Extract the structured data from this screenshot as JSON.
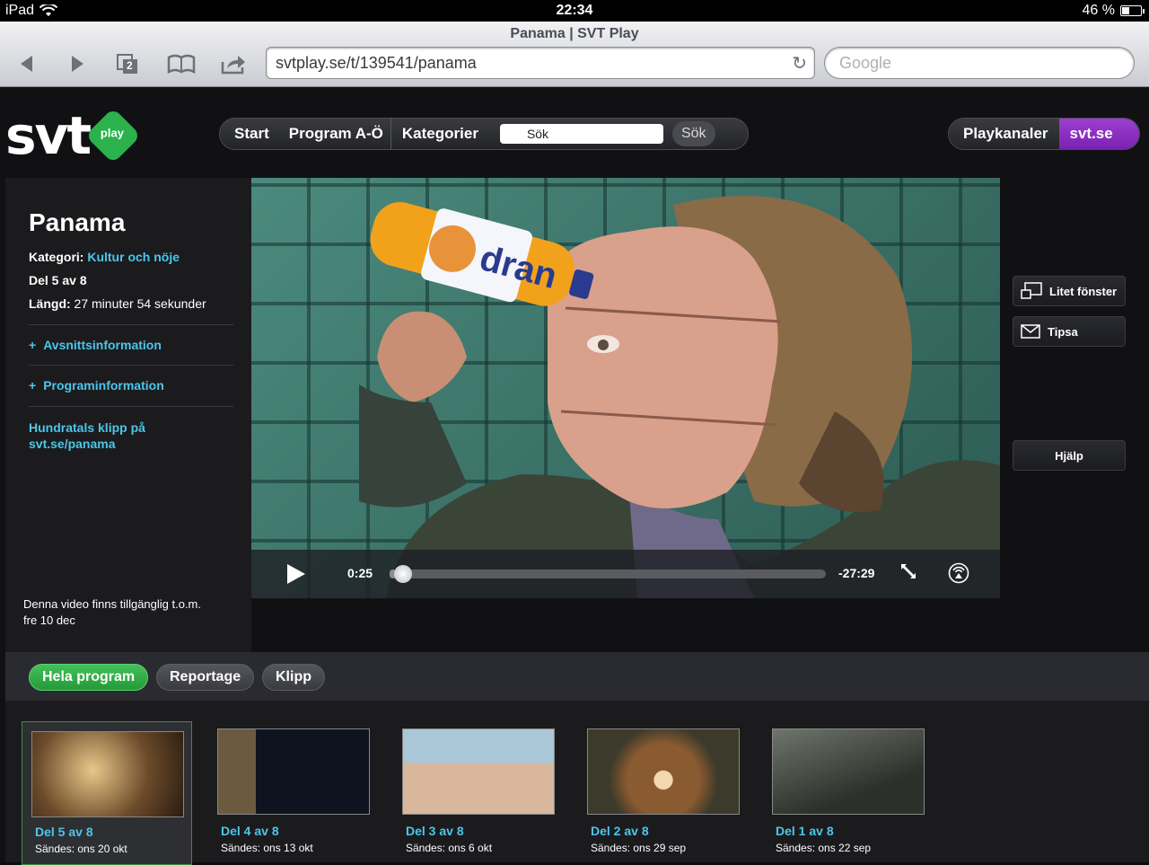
{
  "statusbar": {
    "device": "iPad",
    "time": "22:34",
    "battery": "46 %",
    "battery_level": 0.46
  },
  "browser": {
    "title": "Panama | SVT Play",
    "url": "svtplay.se/t/139541/panama",
    "tab_count": "2",
    "search_placeholder": "Google"
  },
  "header": {
    "logo_text": "svt",
    "logo_badge": "play",
    "nav": [
      "Start",
      "Program A-Ö",
      "Kategorier"
    ],
    "search_value": "Sök",
    "search_button": "Sök",
    "playkanaler": "Playkanaler",
    "svtse": "svt.se"
  },
  "info": {
    "title": "Panama",
    "category_label": "Kategori:",
    "category_value": "Kultur och nöje",
    "episode": "Del 5 av 8",
    "length_label": "Längd:",
    "length_value": "27 minuter 54 sekunder",
    "expanders": [
      "Avsnittsinformation",
      "Programinformation"
    ],
    "clips_link_line1": "Hundratals klipp på",
    "clips_link_line2": "svt.se/panama",
    "availability_line1": "Denna video finns tillgänglig t.o.m.",
    "availability_line2": "fre 10 dec"
  },
  "player": {
    "elapsed": "0:25",
    "remaining": "-27:29",
    "progress": 0.015,
    "bottle_label": "dran"
  },
  "side_buttons": {
    "small_window": "Litet fönster",
    "tip": "Tipsa",
    "help": "Hjälp"
  },
  "tabs": [
    "Hela program",
    "Reportage",
    "Klipp"
  ],
  "episodes": [
    {
      "title": "Del 5 av 8",
      "date": "Sändes: ons 20 okt"
    },
    {
      "title": "Del 4 av 8",
      "date": "Sändes: ons 13 okt"
    },
    {
      "title": "Del 3 av 8",
      "date": "Sändes: ons 6 okt"
    },
    {
      "title": "Del 2 av 8",
      "date": "Sändes: ons 29 sep"
    },
    {
      "title": "Del 1 av 8",
      "date": "Sändes: ons 22 sep"
    }
  ],
  "colors": {
    "accent_green": "#249a38",
    "link_blue": "#4cc6e8",
    "svtse_purple": "#7a22b2"
  }
}
